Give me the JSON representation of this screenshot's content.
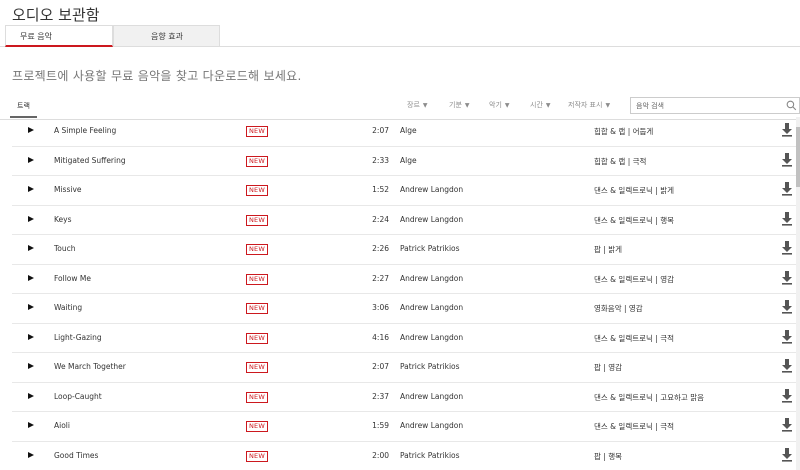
{
  "page": {
    "title": "오디오 보관함"
  },
  "tabs": [
    {
      "label": "무료 음악",
      "active": true
    },
    {
      "label": "음향 효과",
      "active": false
    }
  ],
  "intro": "프로젝트에 사용할 무료 음악을 찾고 다운로드해 보세요.",
  "toolbar": {
    "track_tab": "트랙",
    "filters": [
      {
        "label": "장르"
      },
      {
        "label": "기분"
      },
      {
        "label": "악기"
      },
      {
        "label": "시간"
      },
      {
        "label": "저작자 표시"
      }
    ],
    "search_placeholder": "음악 검색"
  },
  "badge_label": "NEW",
  "colors": {
    "accent": "#cc181e",
    "text": "#333333",
    "muted": "#767676"
  },
  "tracks": [
    {
      "title": "A Simple Feeling",
      "duration": "2:07",
      "artist": "Alge",
      "genre": "힙합 & 랩 | 어둡게"
    },
    {
      "title": "Mitigated Suffering",
      "duration": "2:33",
      "artist": "Alge",
      "genre": "힙합 & 랩 | 극적"
    },
    {
      "title": "Missive",
      "duration": "1:52",
      "artist": "Andrew Langdon",
      "genre": "댄스 & 일렉트로닉 | 밝게"
    },
    {
      "title": "Keys",
      "duration": "2:24",
      "artist": "Andrew Langdon",
      "genre": "댄스 & 일렉트로닉 | 행복"
    },
    {
      "title": "Touch",
      "duration": "2:26",
      "artist": "Patrick Patrikios",
      "genre": "팝 | 밝게"
    },
    {
      "title": "Follow Me",
      "duration": "2:27",
      "artist": "Andrew Langdon",
      "genre": "댄스 & 일렉트로닉 | 영감"
    },
    {
      "title": "Waiting",
      "duration": "3:06",
      "artist": "Andrew Langdon",
      "genre": "영화음악 | 영감"
    },
    {
      "title": "Light-Gazing",
      "duration": "4:16",
      "artist": "Andrew Langdon",
      "genre": "댄스 & 일렉트로닉 | 극적"
    },
    {
      "title": "We March Together",
      "duration": "2:07",
      "artist": "Patrick Patrikios",
      "genre": "팝 | 영감"
    },
    {
      "title": "Loop-Caught",
      "duration": "2:37",
      "artist": "Andrew Langdon",
      "genre": "댄스 & 일렉트로닉 | 고요하고 맑음"
    },
    {
      "title": "Aioli",
      "duration": "1:59",
      "artist": "Andrew Langdon",
      "genre": "댄스 & 일렉트로닉 | 극적"
    },
    {
      "title": "Good Times",
      "duration": "2:00",
      "artist": "Patrick Patrikios",
      "genre": "팝 | 행복"
    }
  ]
}
